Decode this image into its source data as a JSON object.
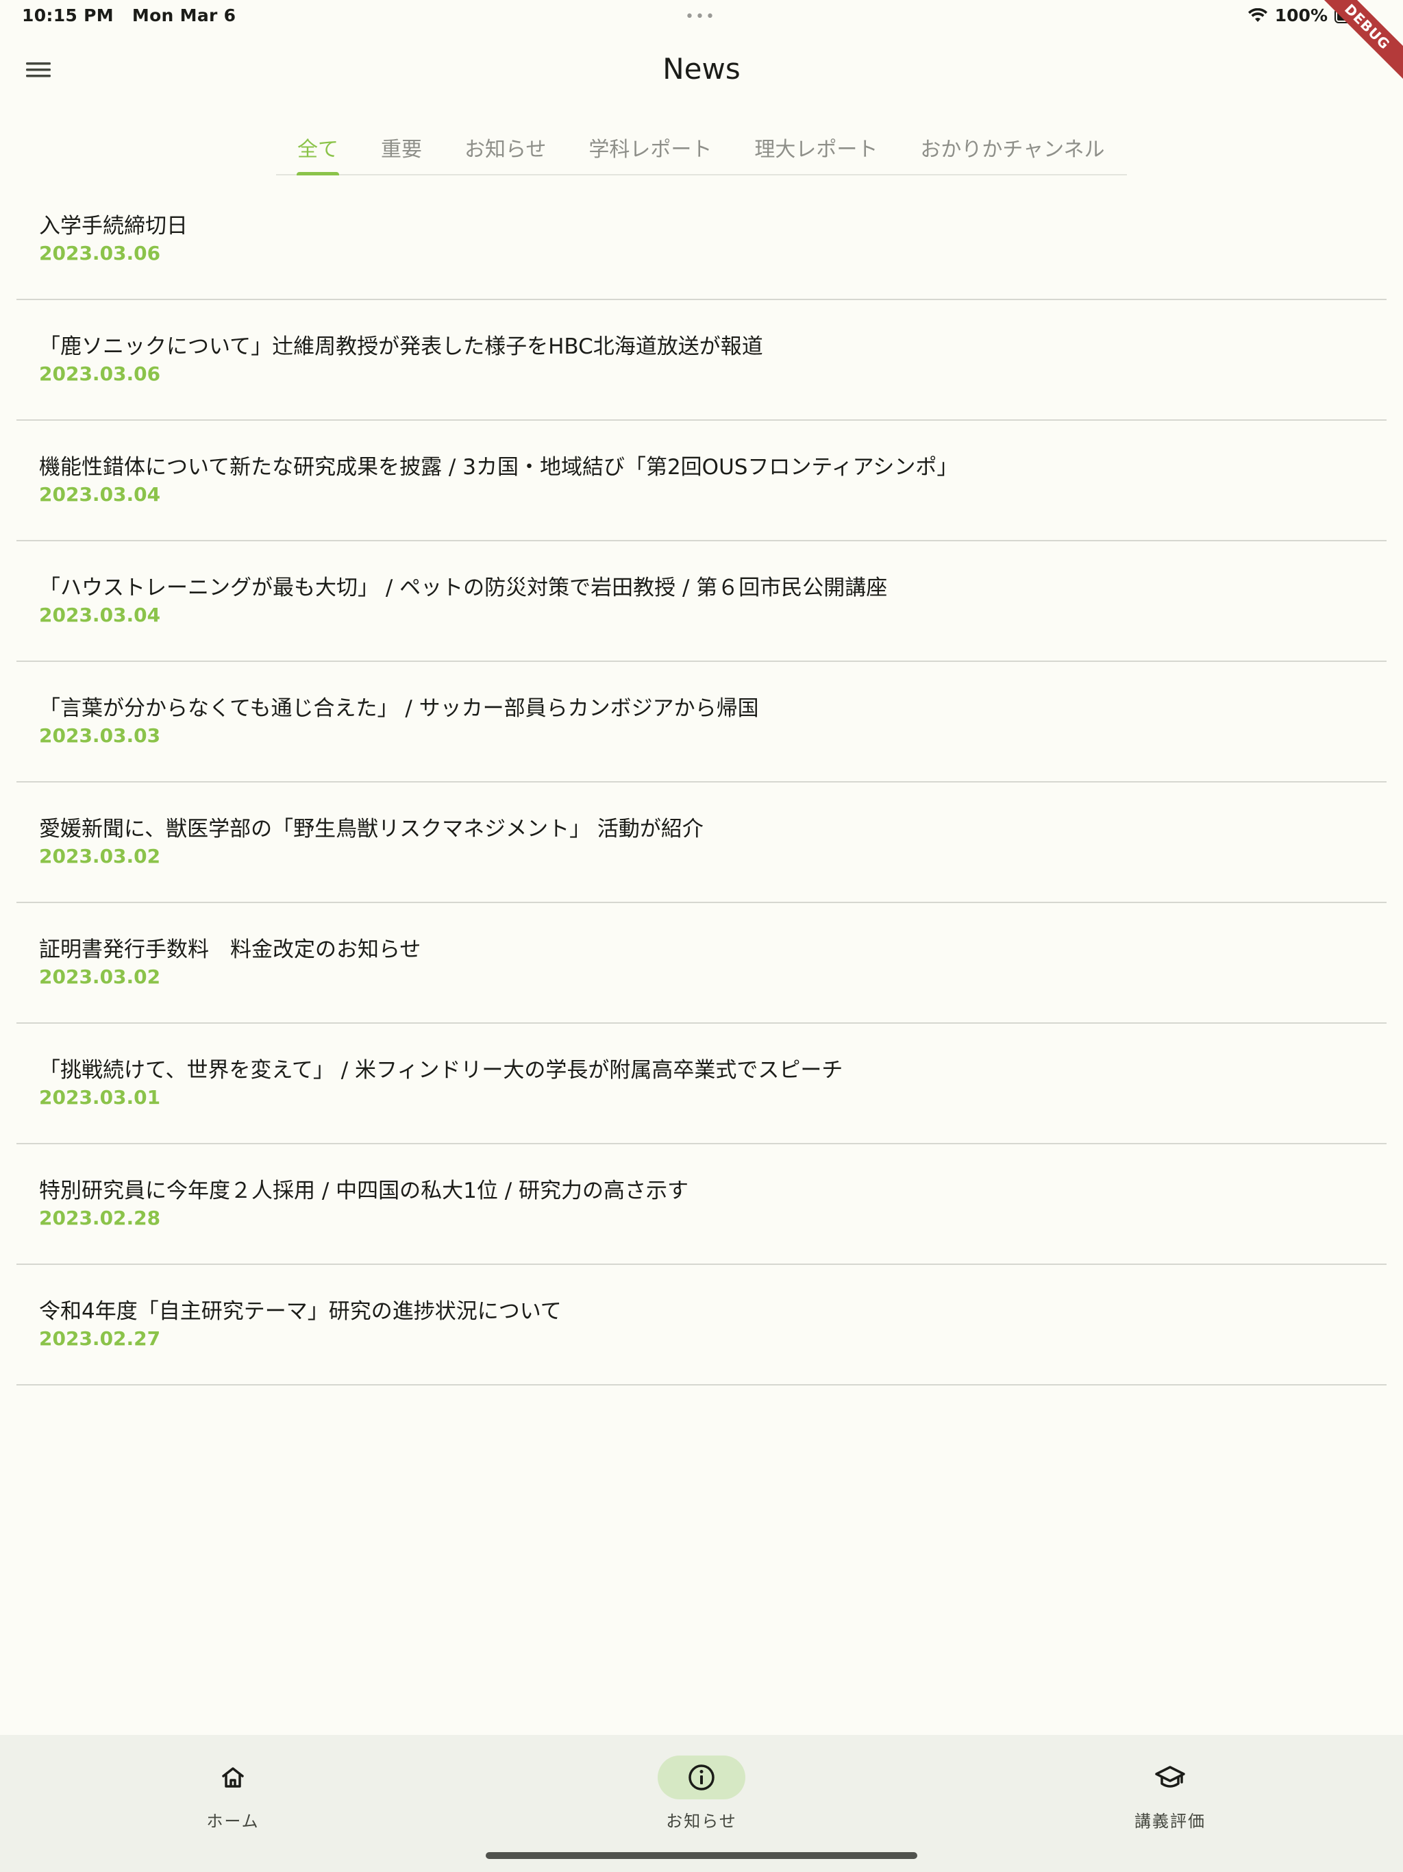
{
  "status_bar": {
    "time": "10:15 PM",
    "date": "Mon Mar 6",
    "battery": "100%",
    "debug_label": "DEBUG"
  },
  "app_bar": {
    "title": "News",
    "menu_icon": "hamburger-menu-icon"
  },
  "tabs": [
    {
      "label": "全て",
      "active": true
    },
    {
      "label": "重要",
      "active": false
    },
    {
      "label": "お知らせ",
      "active": false
    },
    {
      "label": "学科レポート",
      "active": false
    },
    {
      "label": "理大レポート",
      "active": false
    },
    {
      "label": "おかりかチャンネル",
      "active": false
    }
  ],
  "news": [
    {
      "title": "入学手続締切日",
      "date": "2023.03.06"
    },
    {
      "title": "「鹿ソニックについて」辻維周教授が発表した様子をHBC北海道放送が報道",
      "date": "2023.03.06"
    },
    {
      "title": "機能性錯体について新たな研究成果を披露 / 3カ国・地域結び「第2回OUSフロンティアシンポ」",
      "date": "2023.03.04"
    },
    {
      "title": "「ハウストレーニングが最も大切」 / ペットの防災対策で岩田教授 / 第６回市民公開講座",
      "date": "2023.03.04"
    },
    {
      "title": "「言葉が分からなくても通じ合えた」 / サッカー部員らカンボジアから帰国",
      "date": "2023.03.03"
    },
    {
      "title": "愛媛新聞に、獣医学部の「野生鳥獣リスクマネジメント」 活動が紹介",
      "date": "2023.03.02"
    },
    {
      "title": "証明書発行手数料　料金改定のお知らせ",
      "date": "2023.03.02"
    },
    {
      "title": "「挑戦続けて、世界を変えて」 / 米フィンドリー大の学長が附属高卒業式でスピーチ",
      "date": "2023.03.01"
    },
    {
      "title": "特別研究員に今年度２人採用 / 中四国の私大1位 / 研究力の高さ示す",
      "date": "2023.02.28"
    },
    {
      "title": "令和4年度「自主研究テーマ」研究の進捗状況について",
      "date": "2023.02.27"
    }
  ],
  "bottom_nav": {
    "home": {
      "label": "ホーム",
      "icon": "home-icon"
    },
    "news": {
      "label": "お知らせ",
      "icon": "info-icon",
      "active": true
    },
    "lecture": {
      "label": "講義評価",
      "icon": "graduation-cap-icon"
    }
  },
  "colors": {
    "accent": "#8bc34a",
    "background": "#fcfcf6",
    "nav_background": "#eff1ea",
    "active_pill": "#d6e8c4",
    "divider": "#d6d7d0"
  }
}
